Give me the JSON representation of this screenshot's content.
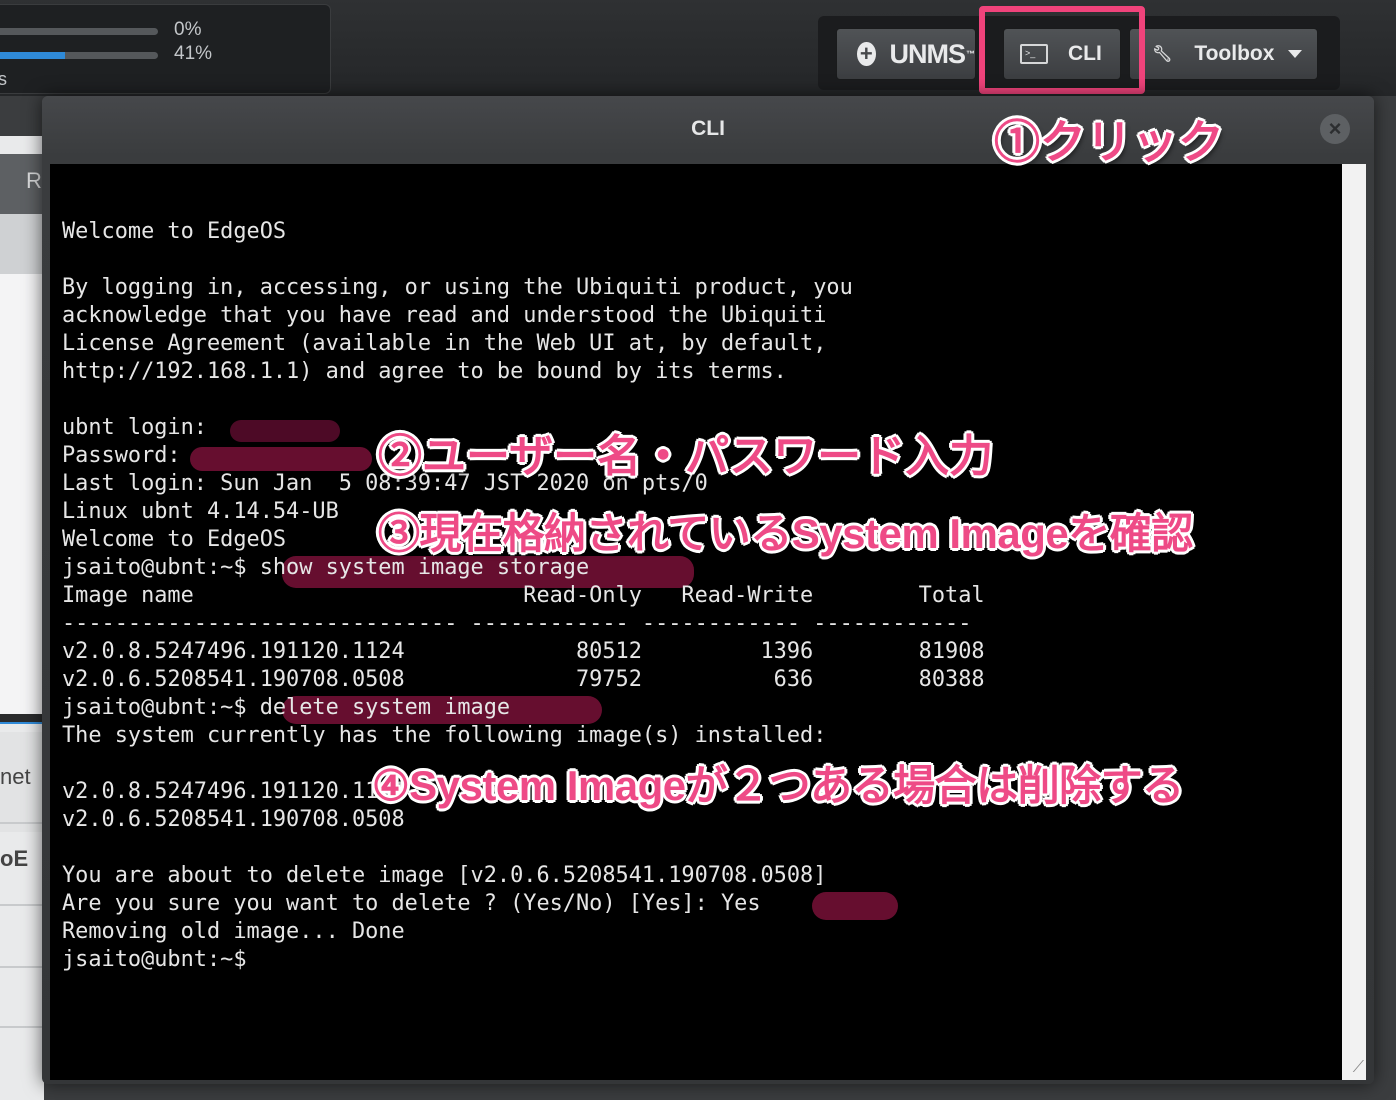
{
  "stats": {
    "rows": [
      {
        "label": "0%",
        "value": 0
      },
      {
        "label": "41%",
        "value": 41
      }
    ],
    "overflow_char": "s"
  },
  "toolbar": {
    "unms_label": "UNMS",
    "unms_tm": "™",
    "cli_label": "CLI",
    "toolbox_label": "Toolbox"
  },
  "background_partial_text": {
    "tab": "R",
    "item_net": "net",
    "item_oe": "oE"
  },
  "modal": {
    "title": "CLI",
    "close_glyph": "×"
  },
  "terminal": {
    "lines": [
      "Welcome to EdgeOS",
      "",
      "By logging in, accessing, or using the Ubiquiti product, you",
      "acknowledge that you have read and understood the Ubiquiti",
      "License Agreement (available in the Web UI at, by default,",
      "http://192.168.1.1) and agree to be bound by its terms.",
      "",
      "ubnt login:",
      "Password:",
      "Last login: Sun Jan  5 08:39:47 JST 2020 on pts/0",
      "Linux ubnt 4.14.54-UB",
      "Welcome to EdgeOS",
      "jsaito@ubnt:~$ show system image storage",
      "Image name                         Read-Only   Read-Write        Total",
      "------------------------------ ------------ ------------ ------------",
      "v2.0.8.5247496.191120.1124             80512         1396        81908",
      "v2.0.6.5208541.190708.0508             79752          636        80388",
      "jsaito@ubnt:~$ delete system image",
      "The system currently has the following image(s) installed:",
      "",
      "v2.0.8.5247496.191120.1124",
      "v2.0.6.5208541.190708.0508",
      "",
      "You are about to delete image [v2.0.6.5208541.190708.0508]",
      "Are you sure you want to delete ? (Yes/No) [Yes]: Yes",
      "Removing old image... Done",
      "jsaito@ubnt:~$"
    ]
  },
  "annotations": {
    "step1": "①クリック",
    "step2": "②ユーザー名・パスワード入力",
    "step3": "③現在格納されているSystem Imageを確認",
    "step4": "④System Imageが２つある場合は削除する"
  },
  "colors": {
    "annotation": "#ee4a86",
    "highlight": "#f0437b",
    "terminal_bg": "#000000",
    "terminal_fg": "#e6e6e6",
    "marker": "#781037"
  }
}
